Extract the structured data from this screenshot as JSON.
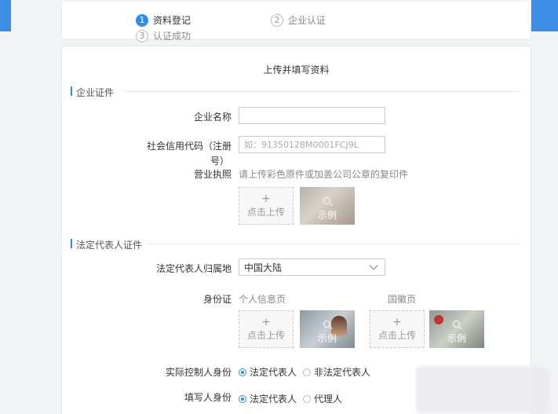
{
  "steps": [
    {
      "num": "1",
      "label": "资料登记",
      "active": true
    },
    {
      "num": "2",
      "label": "企业认证",
      "active": false
    },
    {
      "num": "3",
      "label": "认证成功",
      "active": false
    }
  ],
  "form": {
    "title": "上传并填写资料",
    "section_company": "企业证件",
    "company_name_label": "企业名称",
    "company_name_value": "",
    "credit_code_label_line1": "社会信用代码（注册",
    "credit_code_label_line2": "号）",
    "credit_code_placeholder": "如：91350128M0001FCJ9L",
    "license_label": "营业执照",
    "license_hint": "请上传彩色原件或加盖公司公章的复印件",
    "upload_plus": "+",
    "upload_text": "点击上传",
    "sample_text": "示例",
    "section_legal": "法定代表人证件",
    "region_label": "法定代表人归属地",
    "region_value": "中国大陆",
    "id_label": "身份证",
    "id_front_hint": "个人信息页",
    "id_back_hint": "国徽页",
    "controller_label": "实际控制人身份",
    "controller_options": [
      "法定代表人",
      "非法定代表人"
    ],
    "filler_label": "填写人身份",
    "filler_options": [
      "法定代表人",
      "代理人"
    ]
  }
}
